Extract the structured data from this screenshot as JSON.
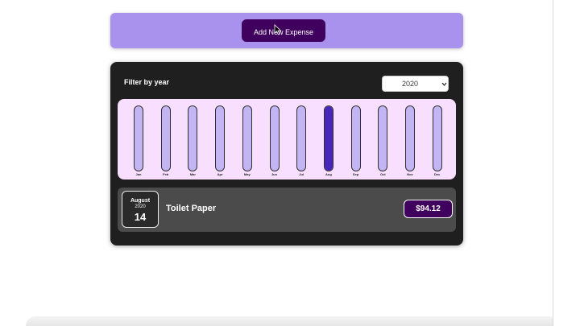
{
  "new_expense": {
    "add_button_label": "Add New Expense"
  },
  "filter": {
    "label": "Filter by year",
    "selected_year": "2020"
  },
  "chart_data": {
    "type": "bar",
    "categories": [
      "Jan",
      "Feb",
      "Mar",
      "Apr",
      "May",
      "Jun",
      "Jul",
      "Aug",
      "Sep",
      "Oct",
      "Nov",
      "Dec"
    ],
    "values": [
      0,
      0,
      0,
      0,
      0,
      0,
      0,
      94.12,
      0,
      0,
      0,
      0
    ],
    "ylim": [
      0,
      94.12
    ]
  },
  "expense": {
    "month": "August",
    "year": "2020",
    "day": "14",
    "title": "Toilet Paper",
    "amount": "$94.12"
  },
  "colors": {
    "accent_panel": "#a892ee",
    "button": "#40005d",
    "card": "#1f1f1f",
    "chart_bg": "#f8dfff",
    "bar_fill": "#4826b9",
    "bar_empty": "#c3b4f3"
  }
}
